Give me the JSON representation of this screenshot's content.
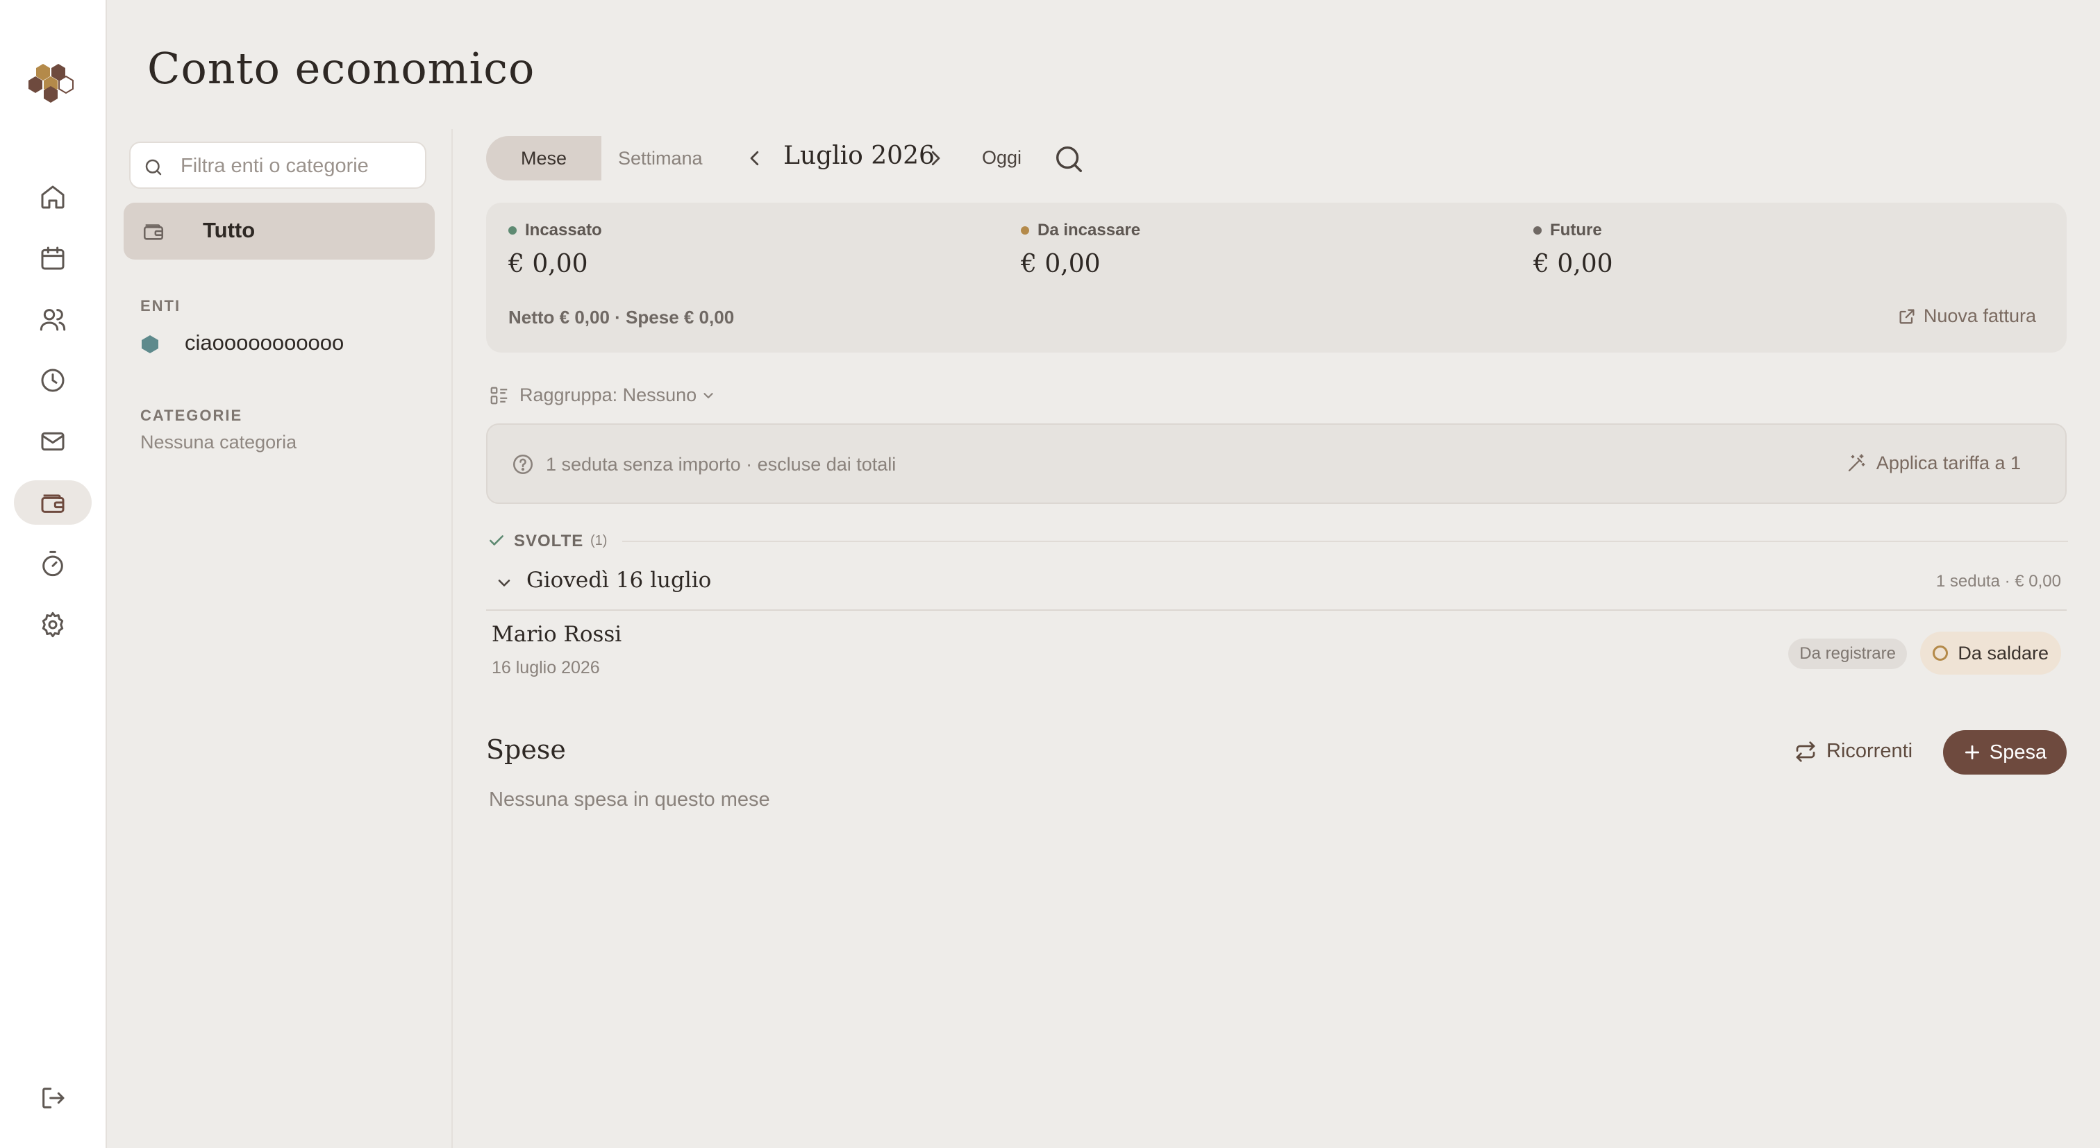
{
  "header": {
    "title": "Conto economico"
  },
  "sidebar_nav": {
    "icons": [
      "home-icon",
      "calendar-icon",
      "users-icon",
      "clock-icon",
      "mail-icon",
      "wallet-icon",
      "timer-icon",
      "gear-icon",
      "logout-icon"
    ],
    "active": "wallet-icon"
  },
  "filters": {
    "search_placeholder": "Filtra enti o categorie",
    "all_label": "Tutto",
    "entities_heading": "ENTI",
    "entities": [
      {
        "name": "ciaooooooooooo",
        "color": "#5e8a8c"
      }
    ],
    "categories_heading": "CATEGORIE",
    "no_categories": "Nessuna categoria"
  },
  "toolbar": {
    "view_month": "Mese",
    "view_week": "Settimana",
    "period": "Luglio 2026",
    "today": "Oggi"
  },
  "summary": {
    "stats": [
      {
        "label": "Incassato",
        "value": "€ 0,00",
        "color": "#5e8a72"
      },
      {
        "label": "Da incassare",
        "value": "€ 0,00",
        "color": "#b48a4a"
      },
      {
        "label": "Future",
        "value": "€ 0,00",
        "color": "#6f6863"
      }
    ],
    "totals": "Netto € 0,00 · Spese € 0,00",
    "new_invoice": "Nuova fattura"
  },
  "grouping": {
    "label": "Raggruppa: Nessuno"
  },
  "notice": {
    "text": "1 seduta senza importo · escluse dai totali",
    "action": "Applica tariffa a 1"
  },
  "sessions": {
    "section_label": "SVOLTE",
    "section_count": "(1)",
    "day_label": "Giovedì 16 luglio",
    "day_summary": "1 seduta · € 0,00",
    "items": [
      {
        "name": "Mario Rossi",
        "date": "16 luglio 2026",
        "badge": "Da registrare",
        "status": "Da saldare"
      }
    ]
  },
  "expenses": {
    "title": "Spese",
    "recurring_label": "Ricorrenti",
    "add_label": "Spesa",
    "empty": "Nessuna spesa in questo mese"
  },
  "colors": {
    "accent": "#6e4a3e",
    "selected_bg": "#d9d1cb"
  }
}
